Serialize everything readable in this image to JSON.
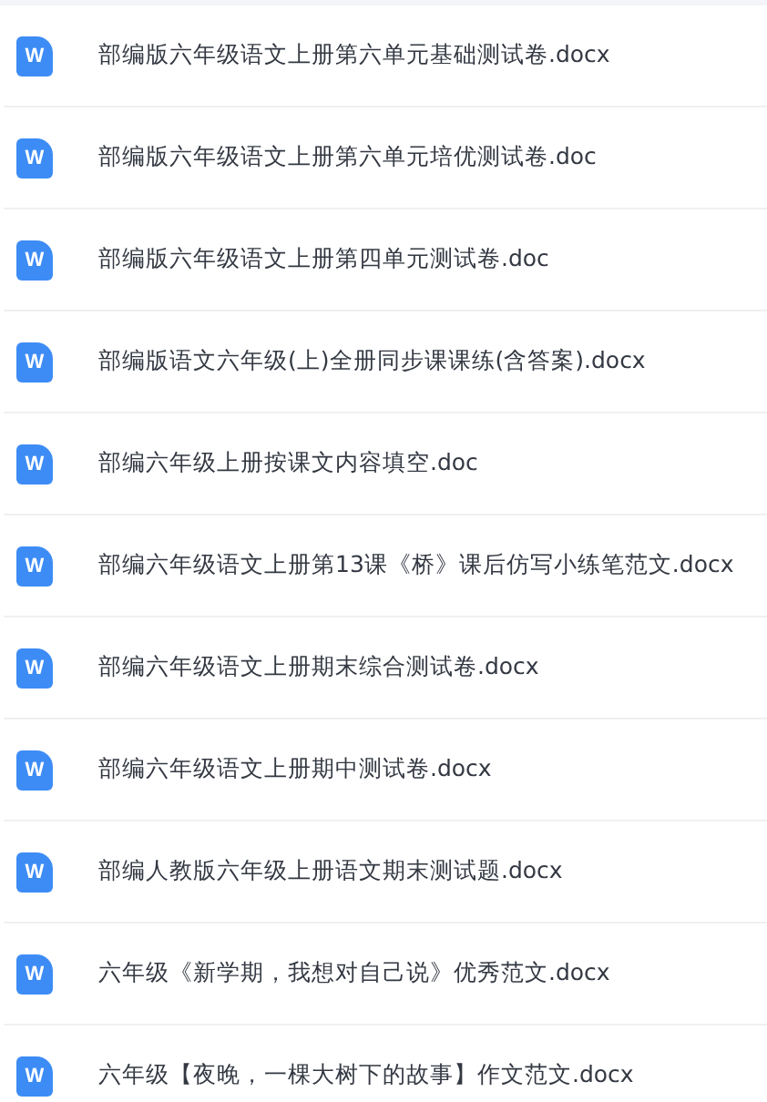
{
  "files": [
    {
      "icon_letter": "W",
      "name": "部编版六年级语文上册第六单元基础测试卷.docx"
    },
    {
      "icon_letter": "W",
      "name": "部编版六年级语文上册第六单元培优测试卷.doc"
    },
    {
      "icon_letter": "W",
      "name": "部编版六年级语文上册第四单元测试卷.doc"
    },
    {
      "icon_letter": "W",
      "name": "部编版语文六年级(上)全册同步课课练(含答案).docx"
    },
    {
      "icon_letter": "W",
      "name": "部编六年级上册按课文内容填空.doc"
    },
    {
      "icon_letter": "W",
      "name": "部编六年级语文上册第13课《桥》课后仿写小练笔范文.docx"
    },
    {
      "icon_letter": "W",
      "name": "部编六年级语文上册期末综合测试卷.docx"
    },
    {
      "icon_letter": "W",
      "name": "部编六年级语文上册期中测试卷.docx"
    },
    {
      "icon_letter": "W",
      "name": "部编人教版六年级上册语文期末测试题.docx"
    },
    {
      "icon_letter": "W",
      "name": "六年级《新学期，我想对自己说》优秀范文.docx"
    },
    {
      "icon_letter": "W",
      "name": "六年级【夜晚，一棵大树下的故事】作文范文.docx"
    }
  ]
}
